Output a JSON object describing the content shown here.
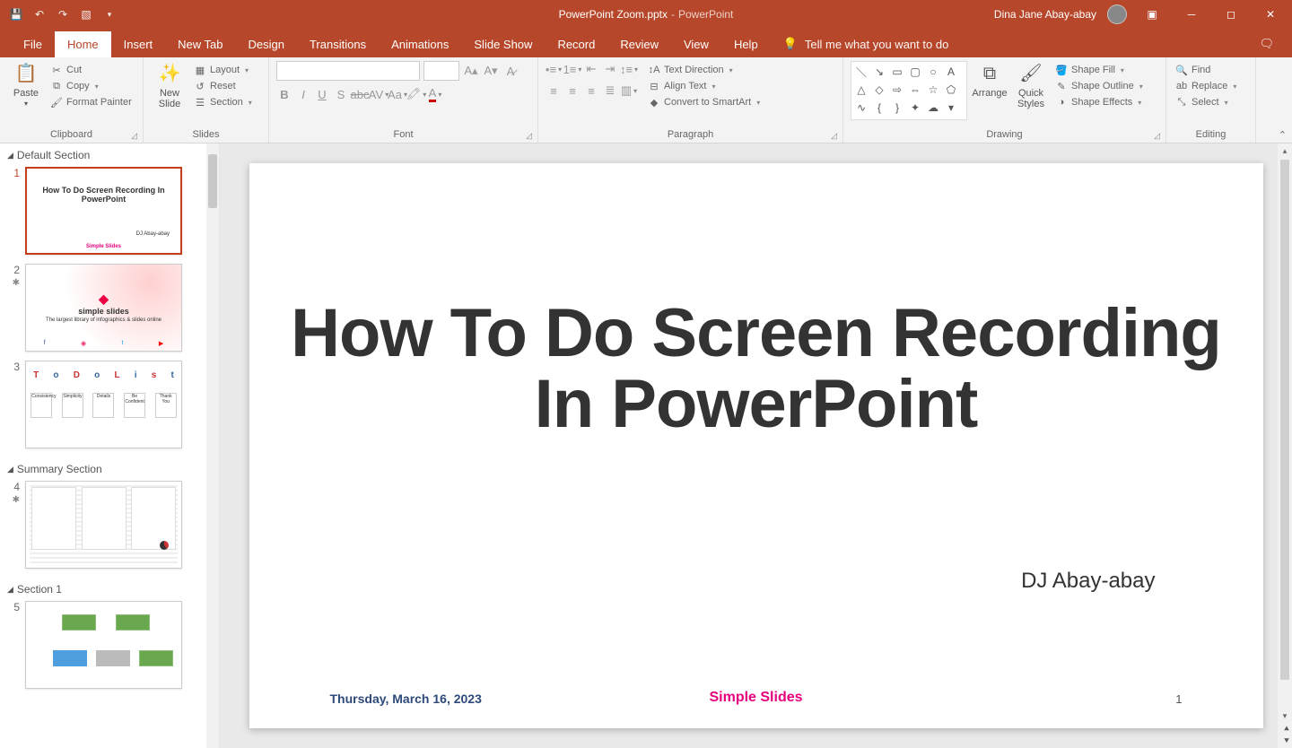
{
  "title": {
    "filename": "PowerPoint Zoom.pptx",
    "app": "PowerPoint"
  },
  "user": {
    "name": "Dina Jane Abay-abay"
  },
  "tabs": {
    "file": "File",
    "home": "Home",
    "insert": "Insert",
    "newtab": "New Tab",
    "design": "Design",
    "transitions": "Transitions",
    "animations": "Animations",
    "slideshow": "Slide Show",
    "record": "Record",
    "review": "Review",
    "view": "View",
    "help": "Help",
    "tellme": "Tell me what you want to do"
  },
  "ribbon": {
    "clipboard": {
      "label": "Clipboard",
      "paste": "Paste",
      "cut": "Cut",
      "copy": "Copy",
      "fmt": "Format Painter"
    },
    "slides": {
      "label": "Slides",
      "newslide": "New\nSlide",
      "layout": "Layout",
      "reset": "Reset",
      "section": "Section"
    },
    "font": {
      "label": "Font"
    },
    "paragraph": {
      "label": "Paragraph",
      "textdir": "Text Direction",
      "align": "Align Text",
      "smartart": "Convert to SmartArt"
    },
    "drawing": {
      "label": "Drawing",
      "arrange": "Arrange",
      "quick": "Quick\nStyles",
      "fill": "Shape Fill",
      "outline": "Shape Outline",
      "effects": "Shape Effects"
    },
    "editing": {
      "label": "Editing",
      "find": "Find",
      "replace": "Replace",
      "select": "Select"
    }
  },
  "sections": {
    "s1": "Default Section",
    "s2": "Summary Section",
    "s3": "Section 1"
  },
  "thumbs": {
    "t1_title": "How To Do Screen Recording In PowerPoint",
    "t1_author": "DJ Abay-abay",
    "t2_brand": "simple slides",
    "t2_tag": "The largest library of infographics & slides online",
    "t3_cards": [
      "Consistency",
      "Simplicity",
      "Details",
      "Be Confident",
      "Thank You"
    ]
  },
  "slide": {
    "title": "How To Do Screen Recording In PowerPoint",
    "author": "DJ Abay-abay",
    "date": "Thursday, March 16, 2023",
    "brand": "Simple Slides",
    "page": "1"
  }
}
